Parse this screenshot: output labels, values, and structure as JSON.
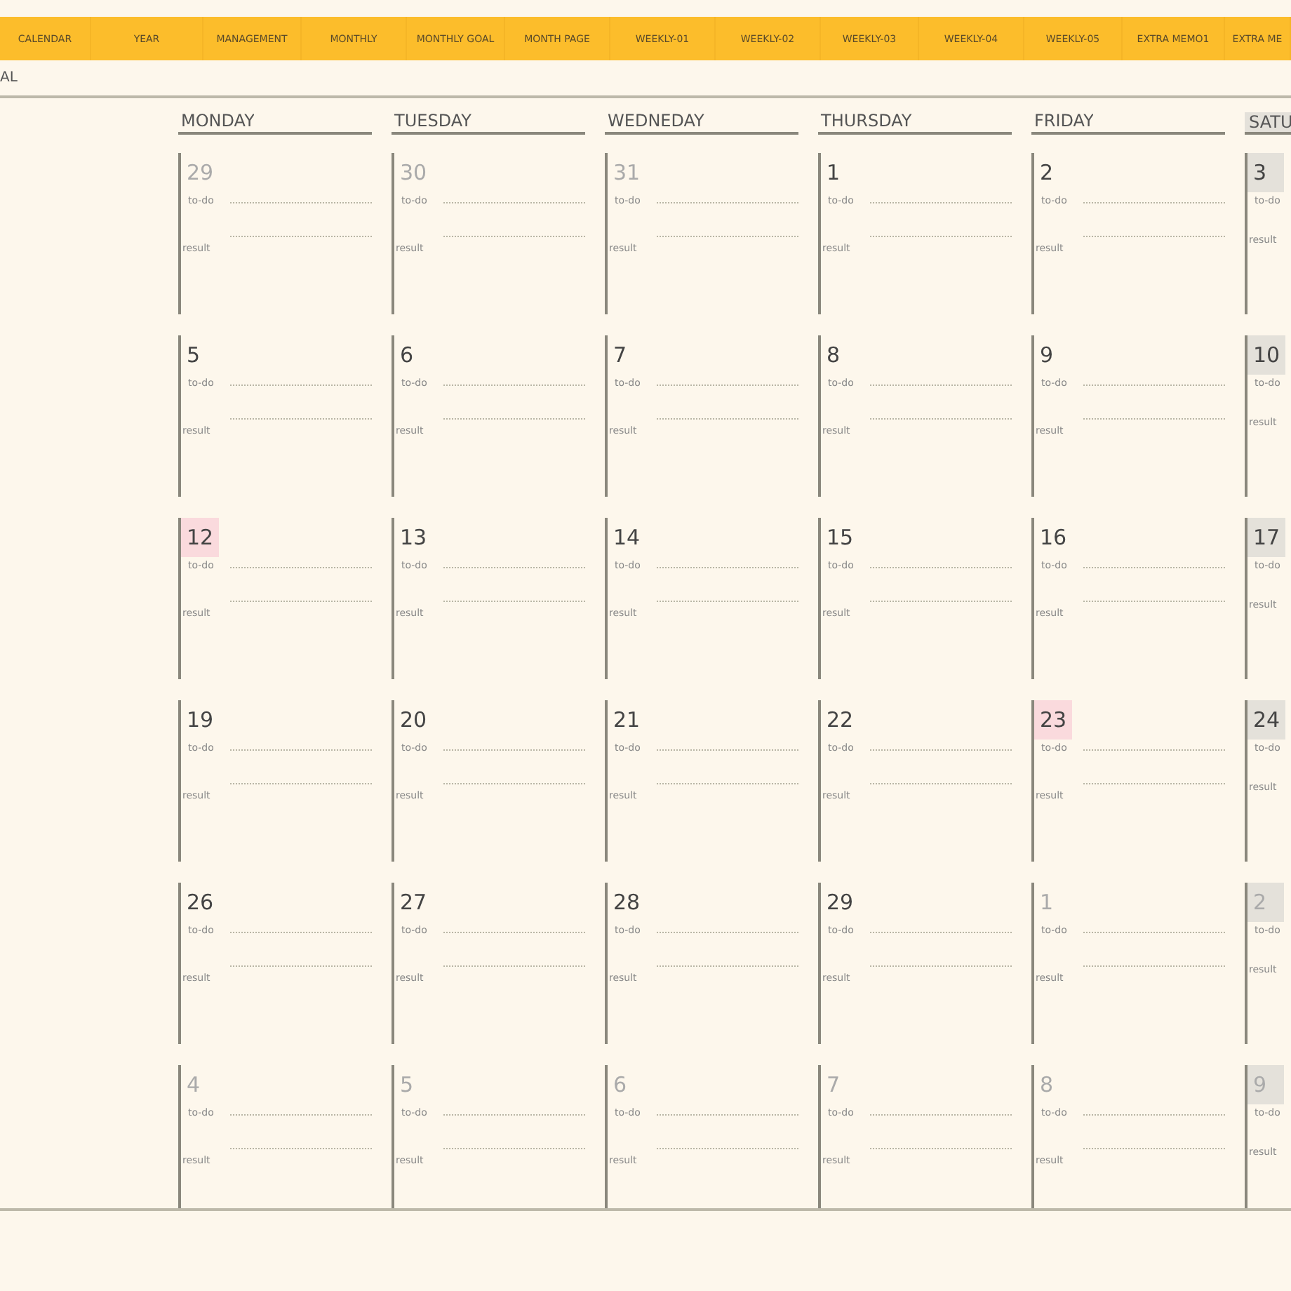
{
  "nav_tabs": [
    {
      "label": "CALENDAR"
    },
    {
      "label": "YEAR"
    },
    {
      "label": "MANAGEMENT"
    },
    {
      "label": "MONTHLY"
    },
    {
      "label": "MONTHLY GOAL"
    },
    {
      "label": "MONTH PAGE"
    },
    {
      "label": "WEEKLY-01"
    },
    {
      "label": "WEEKLY-02"
    },
    {
      "label": "WEEKLY-03"
    },
    {
      "label": "WEEKLY-04"
    },
    {
      "label": "WEEKLY-05"
    },
    {
      "label": "EXTRA MEMO1"
    },
    {
      "label": "EXTRA ME"
    }
  ],
  "page_title": "AL",
  "weekdays": [
    {
      "label": "MONDAY",
      "weekend": false
    },
    {
      "label": "TUESDAY",
      "weekend": false
    },
    {
      "label": "WEDNEDAY",
      "weekend": false
    },
    {
      "label": "THURSDAY",
      "weekend": false
    },
    {
      "label": "FRIDAY",
      "weekend": false
    },
    {
      "label": "SATU",
      "weekend": true
    }
  ],
  "weeks": [
    [
      {
        "day": "29",
        "other_month": true,
        "highlighted": false,
        "todo": "to-do",
        "result": "result"
      },
      {
        "day": "30",
        "other_month": true,
        "highlighted": false,
        "todo": "to-do",
        "result": "result"
      },
      {
        "day": "31",
        "other_month": true,
        "highlighted": false,
        "todo": "to-do",
        "result": "result"
      },
      {
        "day": "1",
        "other_month": false,
        "highlighted": false,
        "todo": "to-do",
        "result": "result"
      },
      {
        "day": "2",
        "other_month": false,
        "highlighted": false,
        "todo": "to-do",
        "result": "result"
      },
      {
        "day": "3",
        "other_month": false,
        "highlighted": false,
        "todo": "to-do",
        "result": "result"
      }
    ],
    [
      {
        "day": "5",
        "other_month": false,
        "highlighted": false,
        "todo": "to-do",
        "result": "result"
      },
      {
        "day": "6",
        "other_month": false,
        "highlighted": false,
        "todo": "to-do",
        "result": "result"
      },
      {
        "day": "7",
        "other_month": false,
        "highlighted": false,
        "todo": "to-do",
        "result": "result"
      },
      {
        "day": "8",
        "other_month": false,
        "highlighted": false,
        "todo": "to-do",
        "result": "result"
      },
      {
        "day": "9",
        "other_month": false,
        "highlighted": false,
        "todo": "to-do",
        "result": "result"
      },
      {
        "day": "10",
        "other_month": false,
        "highlighted": false,
        "todo": "to-do",
        "result": "result"
      }
    ],
    [
      {
        "day": "12",
        "other_month": false,
        "highlighted": true,
        "todo": "to-do",
        "result": "result"
      },
      {
        "day": "13",
        "other_month": false,
        "highlighted": false,
        "todo": "to-do",
        "result": "result"
      },
      {
        "day": "14",
        "other_month": false,
        "highlighted": false,
        "todo": "to-do",
        "result": "result"
      },
      {
        "day": "15",
        "other_month": false,
        "highlighted": false,
        "todo": "to-do",
        "result": "result"
      },
      {
        "day": "16",
        "other_month": false,
        "highlighted": false,
        "todo": "to-do",
        "result": "result"
      },
      {
        "day": "17",
        "other_month": false,
        "highlighted": false,
        "todo": "to-do",
        "result": "result"
      }
    ],
    [
      {
        "day": "19",
        "other_month": false,
        "highlighted": false,
        "todo": "to-do",
        "result": "result"
      },
      {
        "day": "20",
        "other_month": false,
        "highlighted": false,
        "todo": "to-do",
        "result": "result"
      },
      {
        "day": "21",
        "other_month": false,
        "highlighted": false,
        "todo": "to-do",
        "result": "result"
      },
      {
        "day": "22",
        "other_month": false,
        "highlighted": false,
        "todo": "to-do",
        "result": "result"
      },
      {
        "day": "23",
        "other_month": false,
        "highlighted": true,
        "todo": "to-do",
        "result": "result"
      },
      {
        "day": "24",
        "other_month": false,
        "highlighted": false,
        "todo": "to-do",
        "result": "result"
      }
    ],
    [
      {
        "day": "26",
        "other_month": false,
        "highlighted": false,
        "todo": "to-do",
        "result": "result"
      },
      {
        "day": "27",
        "other_month": false,
        "highlighted": false,
        "todo": "to-do",
        "result": "result"
      },
      {
        "day": "28",
        "other_month": false,
        "highlighted": false,
        "todo": "to-do",
        "result": "result"
      },
      {
        "day": "29",
        "other_month": false,
        "highlighted": false,
        "todo": "to-do",
        "result": "result"
      },
      {
        "day": "1",
        "other_month": true,
        "highlighted": false,
        "todo": "to-do",
        "result": "result"
      },
      {
        "day": "2",
        "other_month": true,
        "highlighted": false,
        "todo": "to-do",
        "result": "result"
      }
    ],
    [
      {
        "day": "4",
        "other_month": true,
        "highlighted": false,
        "todo": "to-do",
        "result": "result"
      },
      {
        "day": "5",
        "other_month": true,
        "highlighted": false,
        "todo": "to-do",
        "result": "result"
      },
      {
        "day": "6",
        "other_month": true,
        "highlighted": false,
        "todo": "to-do",
        "result": "result"
      },
      {
        "day": "7",
        "other_month": true,
        "highlighted": false,
        "todo": "to-do",
        "result": "result"
      },
      {
        "day": "8",
        "other_month": true,
        "highlighted": false,
        "todo": "to-do",
        "result": "result"
      },
      {
        "day": "9",
        "other_month": true,
        "highlighted": false,
        "todo": "to-do",
        "result": "result"
      }
    ]
  ]
}
